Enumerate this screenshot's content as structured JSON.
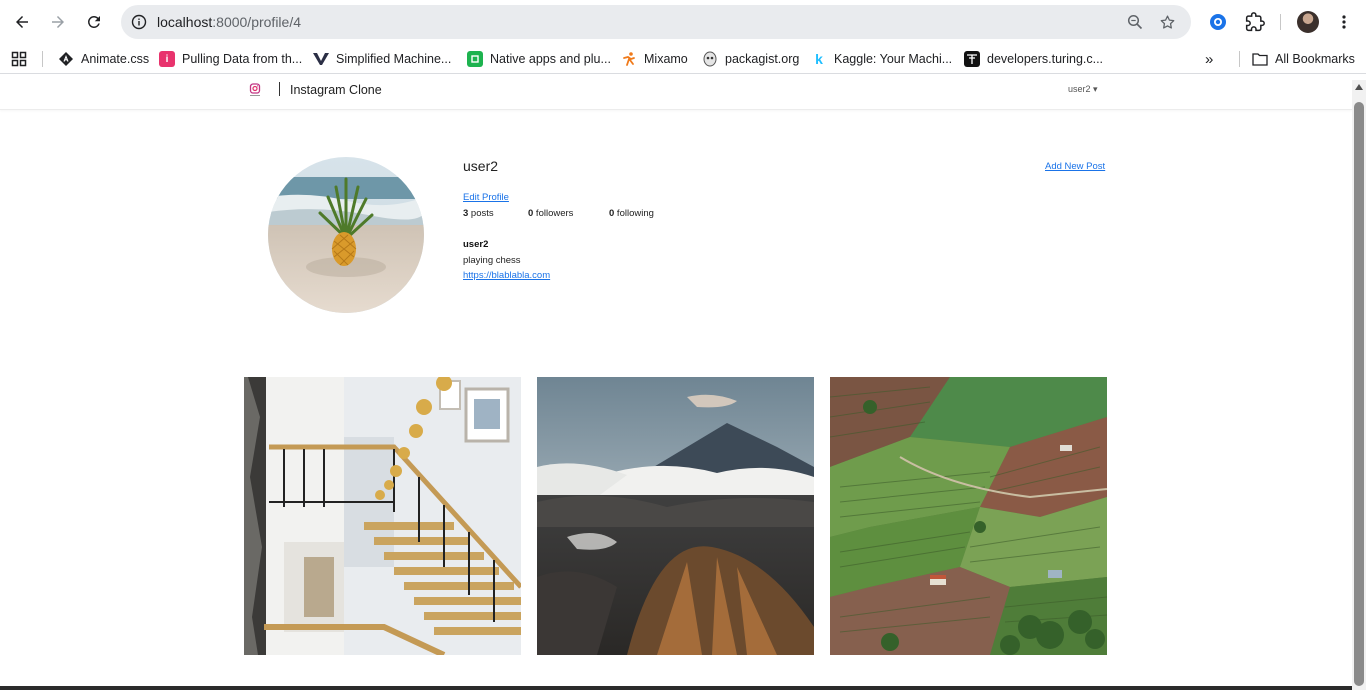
{
  "browser": {
    "url_host": "localhost",
    "url_path": ":8000/profile/4",
    "bookmarks": [
      {
        "label": "Animate.css",
        "icon": "animate-css-icon"
      },
      {
        "label": "Pulling Data from th...",
        "icon": "i-icon"
      },
      {
        "label": "Simplified Machine...",
        "icon": "v-icon"
      },
      {
        "label": "Native apps and plu...",
        "icon": "green-square-icon"
      },
      {
        "label": "Mixamo",
        "icon": "mixamo-icon"
      },
      {
        "label": "packagist.org",
        "icon": "packagist-icon"
      },
      {
        "label": "Kaggle: Your Machi...",
        "icon": "kaggle-icon"
      },
      {
        "label": "developers.turing.c...",
        "icon": "turing-icon"
      }
    ],
    "all_bookmarks": "All Bookmarks",
    "more_bookmarks": "»"
  },
  "app": {
    "brand": "Instagram Clone",
    "user_menu": "user2 ▾"
  },
  "profile": {
    "username": "user2",
    "add_post": "Add New Post",
    "edit_profile": "Edit Profile",
    "posts_count": "3",
    "posts_label": " posts",
    "followers_count": "0",
    "followers_label": " followers",
    "following_count": "0",
    "following_label": " following",
    "bio_name": "user2",
    "bio_text": "playing chess",
    "bio_link": "https://blablabla.com"
  },
  "posts": [
    {
      "name": "staircase-photo"
    },
    {
      "name": "mountain-photo"
    },
    {
      "name": "terraced-fields-photo"
    }
  ],
  "colors": {
    "link": "#1a73e8",
    "omnibox": "#e9ebee"
  }
}
